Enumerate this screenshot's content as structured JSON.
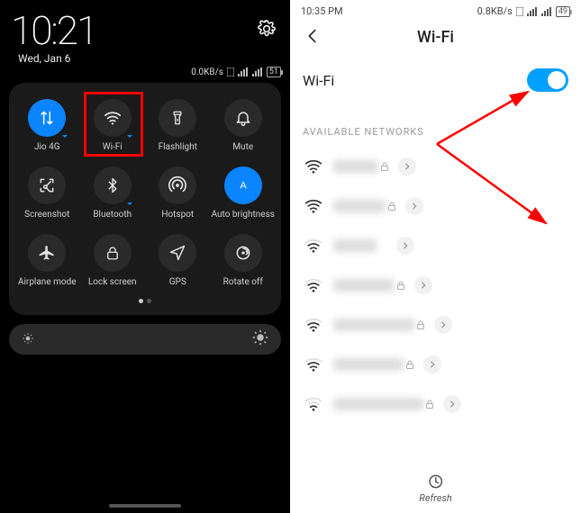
{
  "left": {
    "clock": "10:21",
    "date": "Wed, Jan 6",
    "speed": "0.0KB/s",
    "battery": "51",
    "tiles": [
      {
        "name": "data-toggle",
        "label": "Jio 4G",
        "icon": "arrows",
        "active": true,
        "marker": true
      },
      {
        "name": "wifi-toggle",
        "label": "Wi-Fi",
        "icon": "wifi",
        "active": false,
        "marker": true,
        "highlight": true
      },
      {
        "name": "flashlight-toggle",
        "label": "Flashlight",
        "icon": "flashlight",
        "active": false
      },
      {
        "name": "mute-toggle",
        "label": "Mute",
        "icon": "bell",
        "active": false
      },
      {
        "name": "screenshot-toggle",
        "label": "Screenshot",
        "icon": "scissors",
        "active": false
      },
      {
        "name": "bluetooth-toggle",
        "label": "Bluetooth",
        "icon": "bluetooth",
        "active": false,
        "marker": true
      },
      {
        "name": "hotspot-toggle",
        "label": "Hotspot",
        "icon": "hotspot",
        "active": false
      },
      {
        "name": "auto-brightness-toggle",
        "label": "Auto brightness",
        "icon": "auto-brightness",
        "active": true
      },
      {
        "name": "airplane-toggle",
        "label": "Airplane mode",
        "icon": "airplane",
        "active": false
      },
      {
        "name": "lock-toggle",
        "label": "Lock screen",
        "icon": "lock",
        "active": false
      },
      {
        "name": "gps-toggle",
        "label": "GPS",
        "icon": "gps",
        "active": false
      },
      {
        "name": "rotate-toggle",
        "label": "Rotate off",
        "icon": "rotate",
        "active": false
      }
    ]
  },
  "right": {
    "status_time": "10:35 PM",
    "status_speed": "0.8KB/s",
    "status_battery": "49",
    "title": "Wi-Fi",
    "toggle_label": "Wi-Fi",
    "toggle_on": true,
    "section": "AVAILABLE NETWORKS",
    "networks": [
      {
        "strength": 4,
        "locked": true,
        "name_w": 50
      },
      {
        "strength": 4,
        "locked": true,
        "name_w": 58
      },
      {
        "strength": 3,
        "locked": false,
        "name_w": 48
      },
      {
        "strength": 3,
        "locked": true,
        "name_w": 68
      },
      {
        "strength": 3,
        "locked": true,
        "name_w": 90
      },
      {
        "strength": 3,
        "locked": true,
        "name_w": 78
      },
      {
        "strength": 2,
        "locked": true,
        "name_w": 100
      }
    ],
    "refresh": "Refresh"
  }
}
